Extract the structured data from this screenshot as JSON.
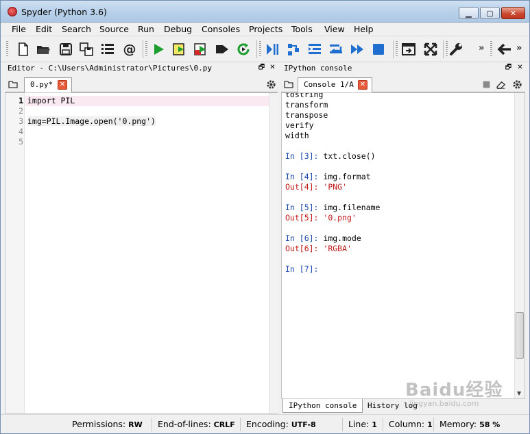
{
  "window": {
    "title": "Spyder (Python 3.6)"
  },
  "menu": [
    "File",
    "Edit",
    "Search",
    "Source",
    "Run",
    "Debug",
    "Consoles",
    "Projects",
    "Tools",
    "View",
    "Help"
  ],
  "toolbar_overflow": "»",
  "editor": {
    "header": "Editor - C:\\Users\\Administrator\\Pictures\\0.py",
    "tab_label": "0.py*",
    "line_numbers": [
      "1",
      "2",
      "3",
      "4",
      "5"
    ],
    "lines": [
      "import PIL",
      "",
      "img=PIL.Image.open('0.png')",
      "",
      ""
    ]
  },
  "console": {
    "header": "IPython console",
    "tab_label": "Console 1/A",
    "lines": [
      {
        "prompt": "",
        "text": "tostring"
      },
      {
        "prompt": "",
        "text": "transform"
      },
      {
        "prompt": "",
        "text": "transpose"
      },
      {
        "prompt": "",
        "text": "verify"
      },
      {
        "prompt": "",
        "text": "width"
      },
      {
        "prompt": "",
        "text": ""
      },
      {
        "prompt": "In [3]:",
        "text": " txt.close()"
      },
      {
        "prompt": "",
        "text": ""
      },
      {
        "prompt": "In [4]:",
        "text": " img.format"
      },
      {
        "prompt": "Out[4]:",
        "text": " 'PNG'"
      },
      {
        "prompt": "",
        "text": ""
      },
      {
        "prompt": "In [5]:",
        "text": " img.filename"
      },
      {
        "prompt": "Out[5]:",
        "text": " '0.png'"
      },
      {
        "prompt": "",
        "text": ""
      },
      {
        "prompt": "In [6]:",
        "text": " img.mode"
      },
      {
        "prompt": "Out[6]:",
        "text": " 'RGBA'"
      },
      {
        "prompt": "",
        "text": ""
      },
      {
        "prompt": "In [7]:",
        "text": ""
      }
    ],
    "bottom_tabs": [
      "IPython console",
      "History log"
    ]
  },
  "status": {
    "permissions_label": "Permissions:",
    "permissions_value": "RW",
    "eol_label": "End-of-lines:",
    "eol_value": "CRLF",
    "encoding_label": "Encoding:",
    "encoding_value": "UTF-8",
    "line_label": "Line:",
    "line_value": "1",
    "column_label": "Column:",
    "column_value": "1",
    "memory_label": "Memory:",
    "memory_value": "58 %"
  },
  "watermark": {
    "text": "Baidu经验",
    "sub": "jingyan.baidu.com"
  },
  "colors": {
    "prompt_in": "#1a46b0",
    "prompt_out": "#c21717",
    "current_line": "#fbe9f2",
    "close_badge": "#e85b3a"
  }
}
